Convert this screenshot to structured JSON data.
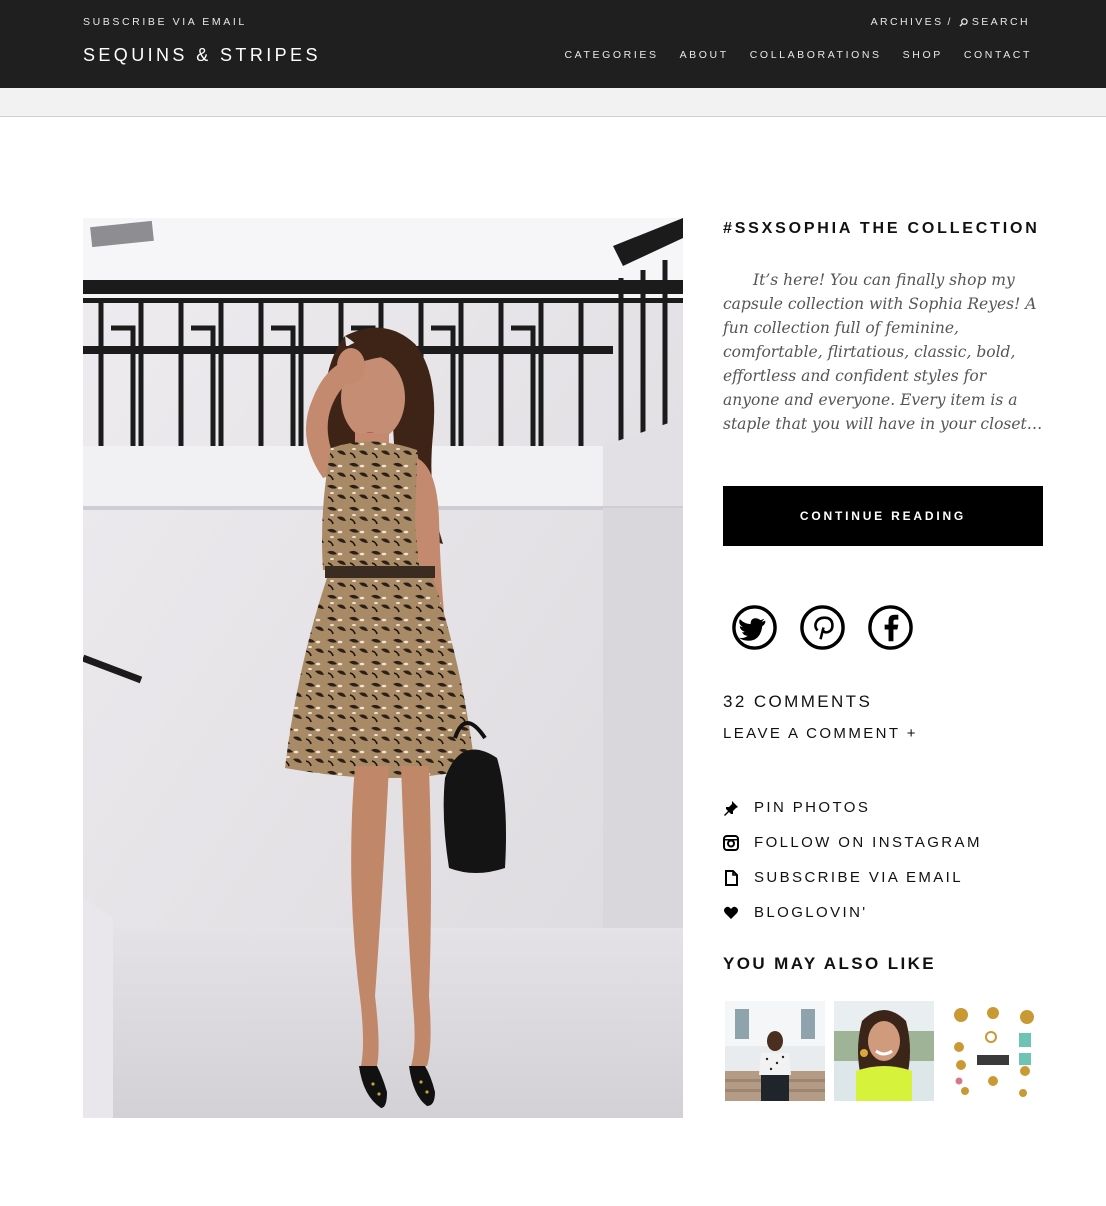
{
  "header": {
    "subscribe_label": "SUBSCRIBE VIA EMAIL",
    "site_title": "SEQUINS & STRIPES",
    "archives_label": "ARCHIVES",
    "separator": "/",
    "search_label": "SEARCH",
    "nav": [
      "CATEGORIES",
      "ABOUT",
      "COLLABORATIONS",
      "SHOP",
      "CONTACT"
    ]
  },
  "post": {
    "title": "#SSXSOPHIA THE COLLECTION",
    "excerpt": "It’s here! You can finally shop my capsule collection with Sophia Reyes! A fun collection full of feminine, comfortable, flirtatious, classic, bold, effortless and confident styles for anyone and everyone. Every item is a staple that you will have in your closet…",
    "continue_label": "CONTINUE READING"
  },
  "share": {
    "icons": [
      "twitter-icon",
      "pinterest-icon",
      "facebook-icon"
    ]
  },
  "comments": {
    "count_label": "32 COMMENTS",
    "leave_label": "LEAVE A COMMENT +"
  },
  "follow_links": [
    {
      "icon": "pin-icon",
      "label": "PIN PHOTOS"
    },
    {
      "icon": "instagram-icon",
      "label": "FOLLOW ON INSTAGRAM"
    },
    {
      "icon": "document-icon",
      "label": "SUBSCRIBE VIA EMAIL"
    },
    {
      "icon": "heart-icon",
      "label": "BLOGLOVIN'"
    }
  ],
  "related": {
    "title": "YOU MAY ALSO LIKE"
  },
  "colors": {
    "header_bg": "#1f1f1f",
    "cta_bg": "#000000",
    "excerpt_text": "#555555"
  }
}
